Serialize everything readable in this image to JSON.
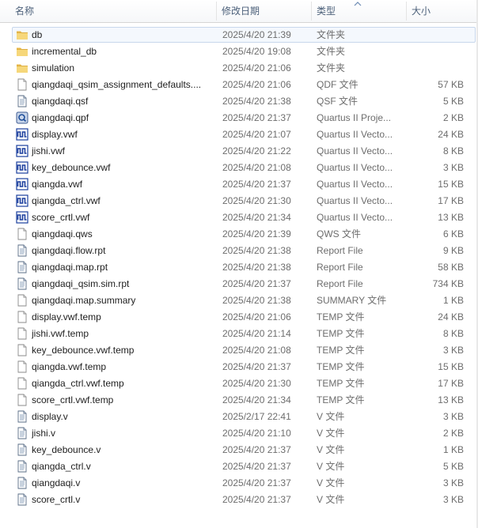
{
  "columns": {
    "name": "名称",
    "date": "修改日期",
    "type": "类型",
    "size": "大小"
  },
  "files": [
    {
      "name": "db",
      "date": "2025/4/20 21:39",
      "type": "文件夹",
      "size": "",
      "icon": "folder-icon",
      "selected": true
    },
    {
      "name": "incremental_db",
      "date": "2025/4/20 19:08",
      "type": "文件夹",
      "size": "",
      "icon": "folder-icon"
    },
    {
      "name": "simulation",
      "date": "2025/4/20 21:06",
      "type": "文件夹",
      "size": "",
      "icon": "folder-icon"
    },
    {
      "name": "qiangdaqi_qsim_assignment_defaults....",
      "date": "2025/4/20 21:06",
      "type": "QDF 文件",
      "size": "57 KB",
      "icon": "blank-file-icon"
    },
    {
      "name": "qiangdaqi.qsf",
      "date": "2025/4/20 21:38",
      "type": "QSF 文件",
      "size": "5 KB",
      "icon": "text-file-icon"
    },
    {
      "name": "qiangdaqi.qpf",
      "date": "2025/4/20 21:37",
      "type": "Quartus II Proje...",
      "size": "2 KB",
      "icon": "quartus-project-icon"
    },
    {
      "name": "display.vwf",
      "date": "2025/4/20 21:07",
      "type": "Quartus II Vecto...",
      "size": "24 KB",
      "icon": "waveform-file-icon"
    },
    {
      "name": "jishi.vwf",
      "date": "2025/4/20 21:22",
      "type": "Quartus II Vecto...",
      "size": "8 KB",
      "icon": "waveform-file-icon"
    },
    {
      "name": "key_debounce.vwf",
      "date": "2025/4/20 21:08",
      "type": "Quartus II Vecto...",
      "size": "3 KB",
      "icon": "waveform-file-icon"
    },
    {
      "name": "qiangda.vwf",
      "date": "2025/4/20 21:37",
      "type": "Quartus II Vecto...",
      "size": "15 KB",
      "icon": "waveform-file-icon"
    },
    {
      "name": "qiangda_ctrl.vwf",
      "date": "2025/4/20 21:30",
      "type": "Quartus II Vecto...",
      "size": "17 KB",
      "icon": "waveform-file-icon"
    },
    {
      "name": "score_crtl.vwf",
      "date": "2025/4/20 21:34",
      "type": "Quartus II Vecto...",
      "size": "13 KB",
      "icon": "waveform-file-icon"
    },
    {
      "name": "qiangdaqi.qws",
      "date": "2025/4/20 21:39",
      "type": "QWS 文件",
      "size": "6 KB",
      "icon": "blank-file-icon"
    },
    {
      "name": "qiangdaqi.flow.rpt",
      "date": "2025/4/20 21:38",
      "type": "Report File",
      "size": "9 KB",
      "icon": "text-file-icon"
    },
    {
      "name": "qiangdaqi.map.rpt",
      "date": "2025/4/20 21:38",
      "type": "Report File",
      "size": "58 KB",
      "icon": "text-file-icon"
    },
    {
      "name": "qiangdaqi_qsim.sim.rpt",
      "date": "2025/4/20 21:37",
      "type": "Report File",
      "size": "734 KB",
      "icon": "text-file-icon"
    },
    {
      "name": "qiangdaqi.map.summary",
      "date": "2025/4/20 21:38",
      "type": "SUMMARY 文件",
      "size": "1 KB",
      "icon": "blank-file-icon"
    },
    {
      "name": "display.vwf.temp",
      "date": "2025/4/20 21:06",
      "type": "TEMP 文件",
      "size": "24 KB",
      "icon": "blank-file-icon"
    },
    {
      "name": "jishi.vwf.temp",
      "date": "2025/4/20 21:14",
      "type": "TEMP 文件",
      "size": "8 KB",
      "icon": "blank-file-icon"
    },
    {
      "name": "key_debounce.vwf.temp",
      "date": "2025/4/20 21:08",
      "type": "TEMP 文件",
      "size": "3 KB",
      "icon": "blank-file-icon"
    },
    {
      "name": "qiangda.vwf.temp",
      "date": "2025/4/20 21:37",
      "type": "TEMP 文件",
      "size": "15 KB",
      "icon": "blank-file-icon"
    },
    {
      "name": "qiangda_ctrl.vwf.temp",
      "date": "2025/4/20 21:30",
      "type": "TEMP 文件",
      "size": "17 KB",
      "icon": "blank-file-icon"
    },
    {
      "name": "score_crtl.vwf.temp",
      "date": "2025/4/20 21:34",
      "type": "TEMP 文件",
      "size": "13 KB",
      "icon": "blank-file-icon"
    },
    {
      "name": "display.v",
      "date": "2025/2/17 22:41",
      "type": "V 文件",
      "size": "3 KB",
      "icon": "text-file-icon"
    },
    {
      "name": "jishi.v",
      "date": "2025/4/20 21:10",
      "type": "V 文件",
      "size": "2 KB",
      "icon": "text-file-icon"
    },
    {
      "name": "key_debounce.v",
      "date": "2025/4/20 21:37",
      "type": "V 文件",
      "size": "1 KB",
      "icon": "text-file-icon"
    },
    {
      "name": "qiangda_ctrl.v",
      "date": "2025/4/20 21:37",
      "type": "V 文件",
      "size": "5 KB",
      "icon": "text-file-icon"
    },
    {
      "name": "qiangdaqi.v",
      "date": "2025/4/20 21:37",
      "type": "V 文件",
      "size": "3 KB",
      "icon": "text-file-icon"
    },
    {
      "name": "score_crtl.v",
      "date": "2025/4/20 21:37",
      "type": "V 文件",
      "size": "3 KB",
      "icon": "text-file-icon"
    }
  ]
}
